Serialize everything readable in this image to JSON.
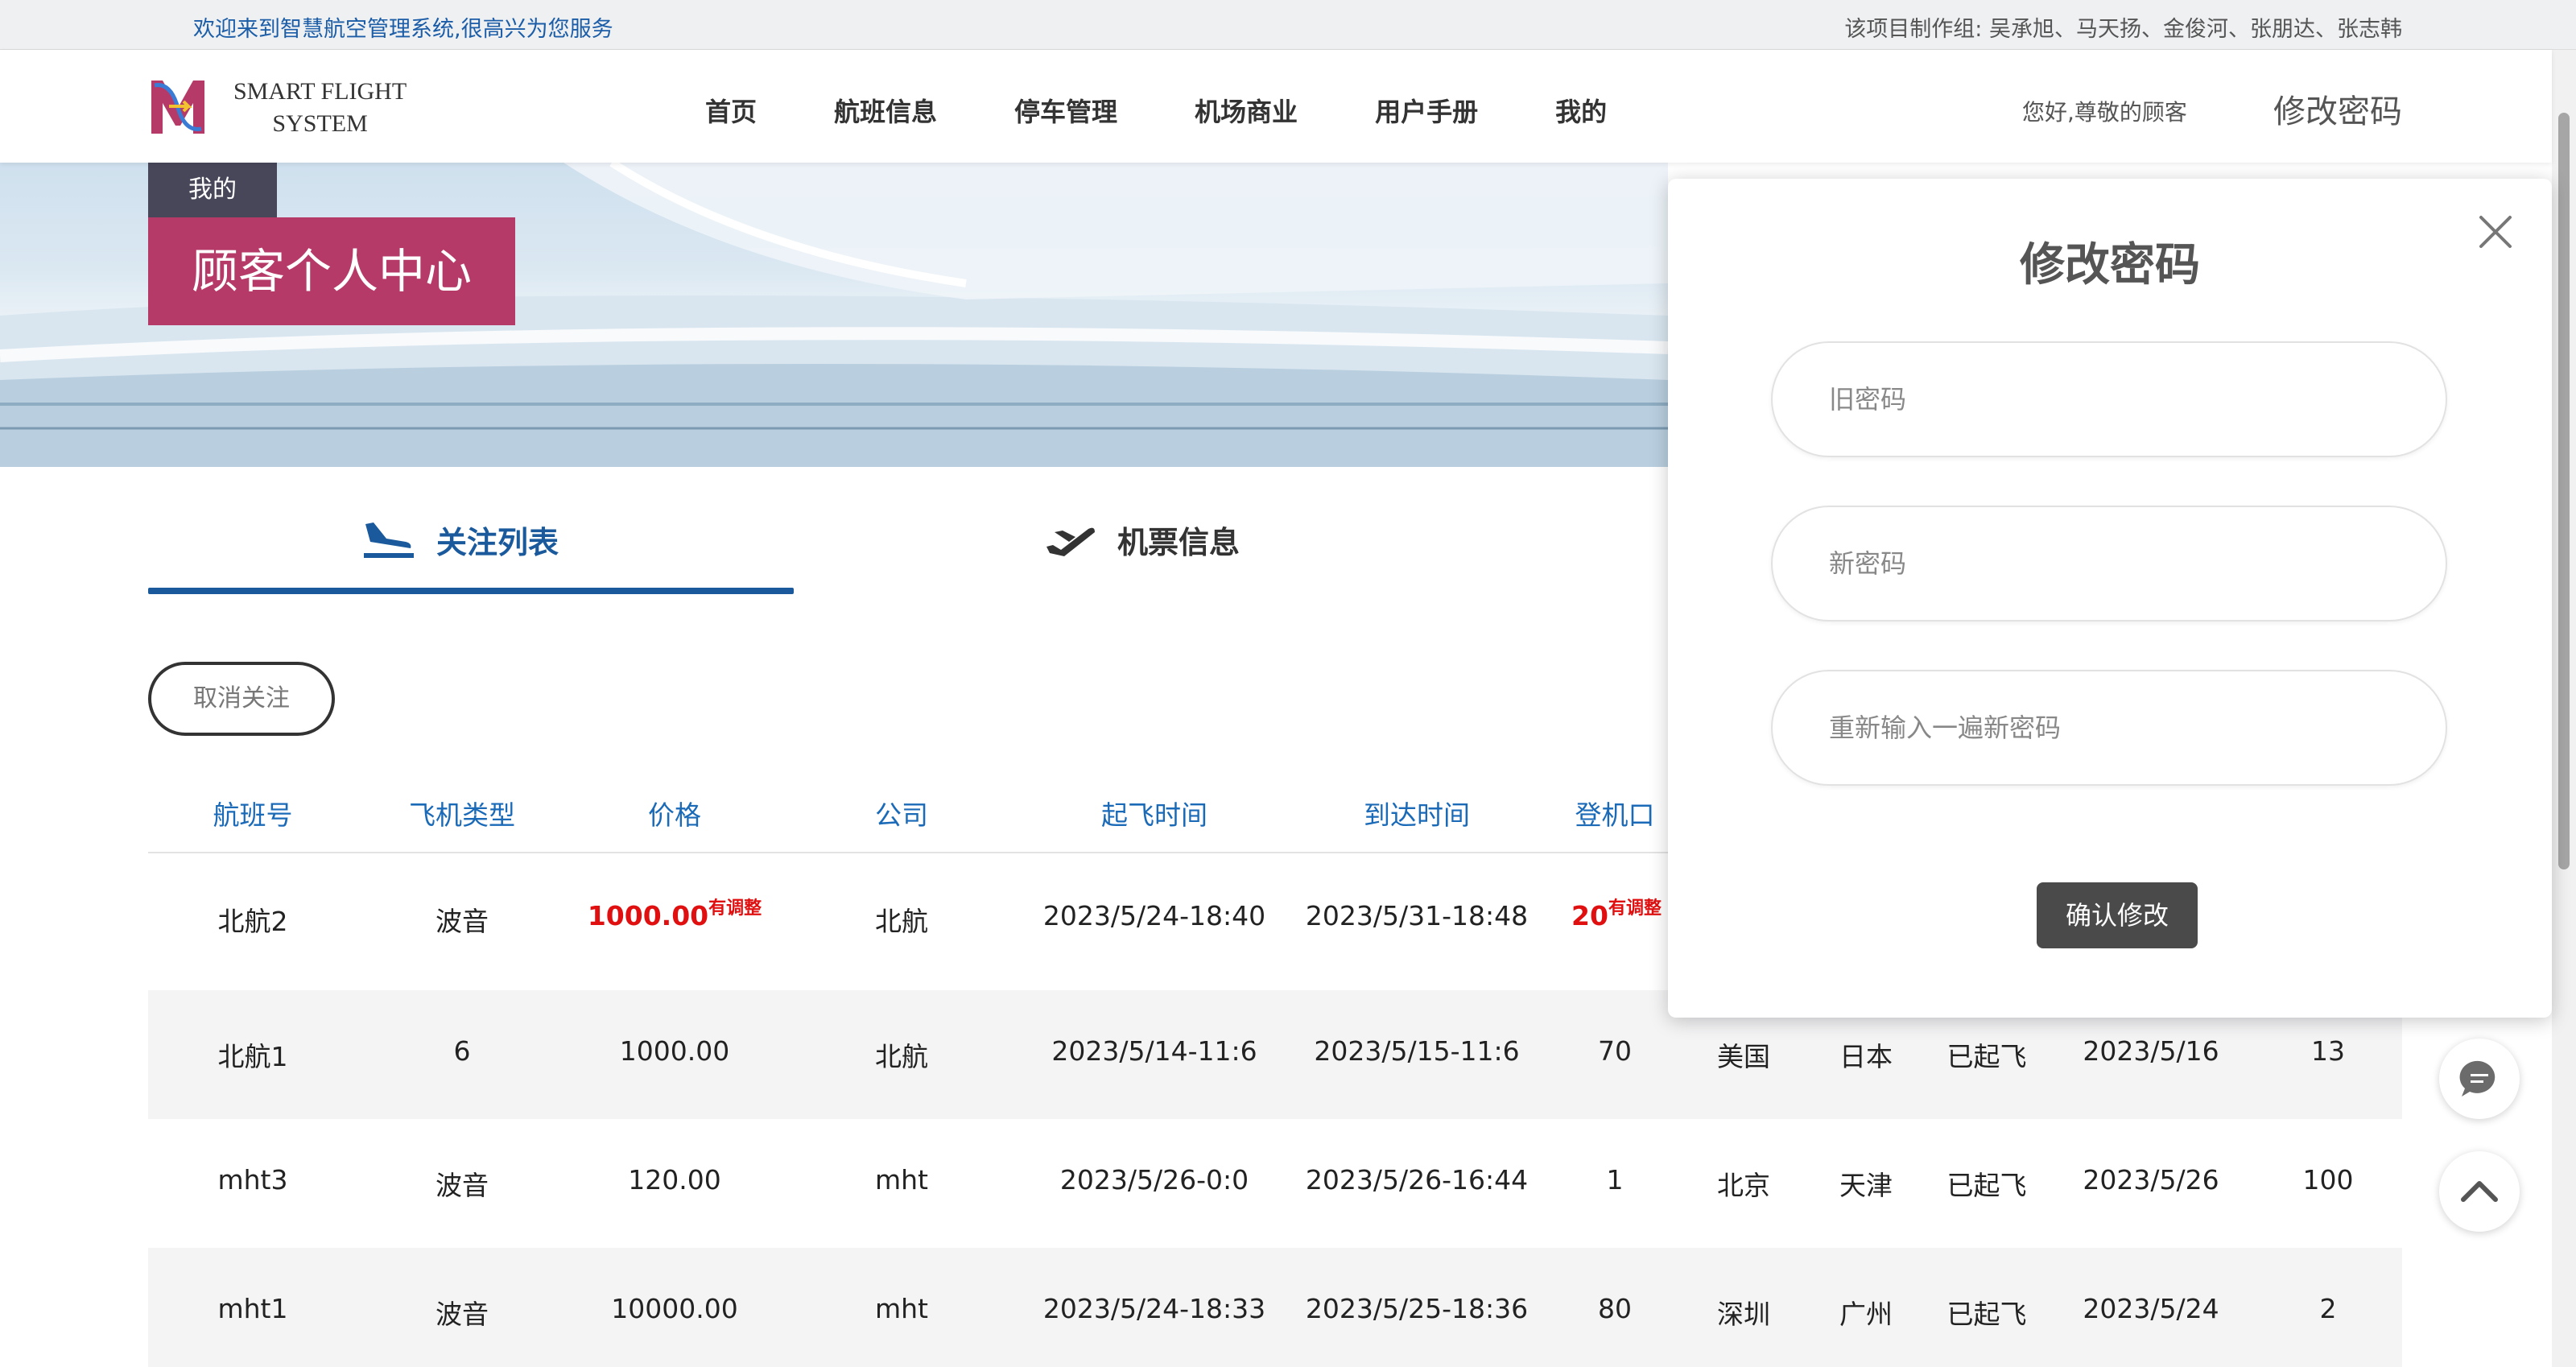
{
  "topbar": {
    "welcome": "欢迎来到智慧航空管理系统,很高兴为您服务",
    "credits": "该项目制作组:  吴承旭、马天扬、金俊河、张朋达、张志韩"
  },
  "brand": {
    "line1": "SMART FLIGHT",
    "line2": "SYSTEM"
  },
  "nav": {
    "items": [
      "首页",
      "航班信息",
      "停车管理",
      "机场商业",
      "用户手册",
      "我的"
    ],
    "greeting": "您好,尊敬的顾客",
    "change_password": "修改密码"
  },
  "banner": {
    "breadcrumb": "我的",
    "title": "顾客个人中心"
  },
  "tabs": {
    "follow": "关注列表",
    "tickets": "机票信息"
  },
  "actions": {
    "cancel_follow": "取消关注"
  },
  "table": {
    "headers": [
      "航班号",
      "飞机类型",
      "价格",
      "公司",
      "起飞时间",
      "到达时间",
      "登机口"
    ],
    "adjust_tag": "有调整",
    "rows": [
      {
        "flight": "北航2",
        "type": "波音",
        "price": "1000.00",
        "company": "北航",
        "depart": "2023/5/24-18:40",
        "arrive": "2023/5/31-18:48",
        "gate": "20"
      },
      {
        "flight": "北航1",
        "type": "6",
        "price": "1000.00",
        "company": "北航",
        "depart": "2023/5/14-11:6",
        "arrive": "2023/5/15-11:6",
        "gate": "70",
        "from": "美国",
        "to": "日本",
        "status": "已起飞",
        "date": "2023/5/16",
        "num": "13"
      },
      {
        "flight": "mht3",
        "type": "波音",
        "price": "120.00",
        "company": "mht",
        "depart": "2023/5/26-0:0",
        "arrive": "2023/5/26-16:44",
        "gate": "1",
        "from": "北京",
        "to": "天津",
        "status": "已起飞",
        "date": "2023/5/26",
        "num": "100"
      },
      {
        "flight": "mht1",
        "type": "波音",
        "price": "10000.00",
        "company": "mht",
        "depart": "2023/5/24-18:33",
        "arrive": "2023/5/25-18:36",
        "gate": "80",
        "from": "深圳",
        "to": "广州",
        "status": "已起飞",
        "date": "2023/5/24",
        "num": "2"
      }
    ]
  },
  "modal": {
    "title": "修改密码",
    "old_placeholder": "旧密码",
    "new_placeholder": "新密码",
    "repeat_placeholder": "重新输入一遍新密码",
    "confirm": "确认修改"
  },
  "colors": {
    "accent_blue": "#1a5a9c",
    "title_pink": "#b63a68",
    "crumb_dark": "#48475a",
    "adjust_red": "#e01010",
    "confirm_bg": "#4a4a4a"
  },
  "icons": {
    "landing": "plane-landing-icon",
    "takeoff": "plane-takeoff-icon",
    "close": "close-icon",
    "chat": "chat-icon",
    "top": "chevron-up-icon"
  }
}
